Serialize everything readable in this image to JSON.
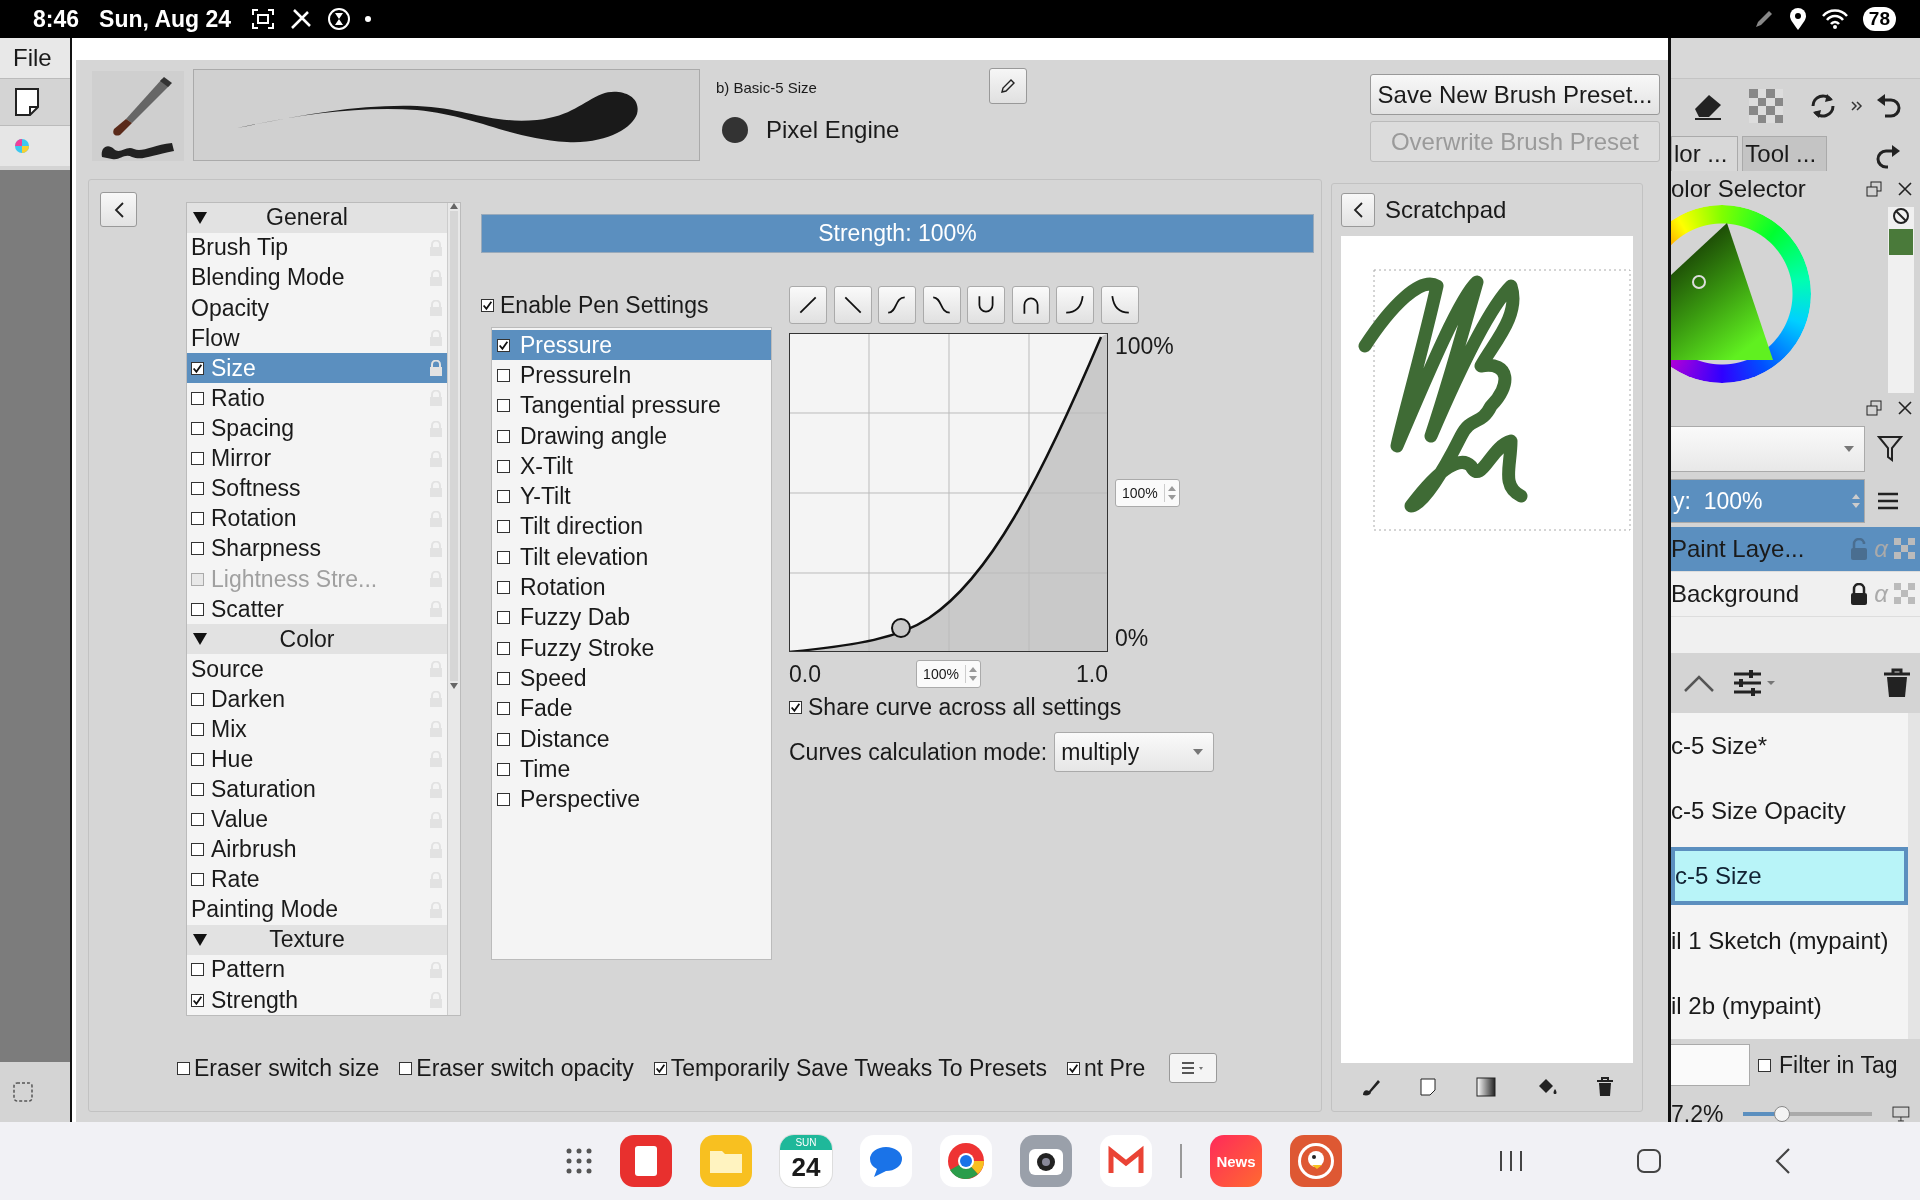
{
  "status_bar": {
    "time": "8:46",
    "date": "Sun, Aug 24",
    "battery": "78"
  },
  "menu": [
    "File"
  ],
  "preset": {
    "name": "b) Basic-5 Size",
    "engine": "Pixel Engine"
  },
  "preset_buttons": [
    {
      "label": "Save New Brush Preset...",
      "disabled": false
    },
    {
      "label": "Overwrite Brush Preset",
      "disabled": true
    }
  ],
  "options": [
    {
      "label": "General",
      "expanded": true,
      "children": [
        {
          "label": "Brush Tip",
          "kind": "plain",
          "selected": false
        },
        {
          "label": "Blending Mode",
          "kind": "plain",
          "selected": false
        },
        {
          "label": "Opacity",
          "kind": "plain",
          "selected": false
        },
        {
          "label": "Flow",
          "kind": "plain",
          "selected": false
        },
        {
          "label": "Size",
          "kind": "check",
          "checked": true,
          "selected": true,
          "disabled": false
        },
        {
          "label": "Ratio",
          "kind": "check",
          "checked": false,
          "selected": false,
          "disabled": false
        },
        {
          "label": "Spacing",
          "kind": "check",
          "checked": false,
          "selected": false,
          "disabled": false
        },
        {
          "label": "Mirror",
          "kind": "check",
          "checked": false,
          "selected": false,
          "disabled": false
        },
        {
          "label": "Softness",
          "kind": "check",
          "checked": false,
          "selected": false,
          "disabled": false
        },
        {
          "label": "Rotation",
          "kind": "check",
          "checked": false,
          "selected": false,
          "disabled": false
        },
        {
          "label": "Sharpness",
          "kind": "check",
          "checked": false,
          "selected": false,
          "disabled": false
        },
        {
          "label": "Lightness Stre...",
          "kind": "check",
          "checked": false,
          "selected": false,
          "disabled": true
        },
        {
          "label": "Scatter",
          "kind": "check",
          "checked": false,
          "selected": false,
          "disabled": false
        }
      ]
    },
    {
      "label": "Color",
      "expanded": true,
      "children": [
        {
          "label": "Source",
          "kind": "plain",
          "selected": false
        },
        {
          "label": "Darken",
          "kind": "check",
          "checked": false,
          "selected": false,
          "disabled": false
        },
        {
          "label": "Mix",
          "kind": "check",
          "checked": false,
          "selected": false,
          "disabled": false
        },
        {
          "label": "Hue",
          "kind": "check",
          "checked": false,
          "selected": false,
          "disabled": false
        },
        {
          "label": "Saturation",
          "kind": "check",
          "checked": false,
          "selected": false,
          "disabled": false
        },
        {
          "label": "Value",
          "kind": "check",
          "checked": false,
          "selected": false,
          "disabled": false
        },
        {
          "label": "Airbrush",
          "kind": "check",
          "checked": false,
          "selected": false,
          "disabled": false
        },
        {
          "label": "Rate",
          "kind": "check",
          "checked": false,
          "selected": false,
          "disabled": false
        },
        {
          "label": "Painting Mode",
          "kind": "plain",
          "selected": false
        }
      ]
    },
    {
      "label": "Texture",
      "expanded": true,
      "children": [
        {
          "label": "Pattern",
          "kind": "check",
          "checked": false,
          "selected": false,
          "disabled": false
        },
        {
          "label": "Strength",
          "kind": "check",
          "checked": true,
          "selected": false,
          "disabled": false
        }
      ]
    }
  ],
  "strength": {
    "label": "Strength: 100%",
    "level": 1
  },
  "pen_settings": {
    "label": "Enable Pen Settings",
    "checked": true
  },
  "sensors": [
    {
      "label": "Pressure",
      "checked": true,
      "selected": true
    },
    {
      "label": "PressureIn",
      "checked": false,
      "selected": false
    },
    {
      "label": "Tangential pressure",
      "checked": false,
      "selected": false
    },
    {
      "label": "Drawing angle",
      "checked": false,
      "selected": false
    },
    {
      "label": "X-Tilt",
      "checked": false,
      "selected": false
    },
    {
      "label": "Y-Tilt",
      "checked": false,
      "selected": false
    },
    {
      "label": "Tilt direction",
      "checked": false,
      "selected": false
    },
    {
      "label": "Tilt elevation",
      "checked": false,
      "selected": false
    },
    {
      "label": "Rotation",
      "checked": false,
      "selected": false
    },
    {
      "label": "Fuzzy Dab",
      "checked": false,
      "selected": false
    },
    {
      "label": "Fuzzy Stroke",
      "checked": false,
      "selected": false
    },
    {
      "label": "Speed",
      "checked": false,
      "selected": false
    },
    {
      "label": "Fade",
      "checked": false,
      "selected": false
    },
    {
      "label": "Distance",
      "checked": false,
      "selected": false
    },
    {
      "label": "Time",
      "checked": false,
      "selected": false
    },
    {
      "label": "Perspective",
      "checked": false,
      "selected": false
    }
  ],
  "curve": {
    "y_max": "100%",
    "y_min": "0%",
    "x_min": "0.0",
    "x_max": "1.0",
    "y_spin": "100%",
    "x_spin": "100%"
  },
  "share_curve": {
    "label": "Share curve across all settings",
    "checked": true
  },
  "calc_mode": {
    "label": "Curves calculation mode:",
    "value": "multiply"
  },
  "scratchpad": {
    "title": "Scratchpad"
  },
  "bottom_options": [
    {
      "label": "Eraser switch size",
      "checked": false
    },
    {
      "label": "Eraser switch opacity",
      "checked": false
    },
    {
      "label": "Temporarily Save Tweaks To Presets",
      "checked": true
    },
    {
      "label": "nt Pre",
      "checked": true
    }
  ],
  "docker": {
    "tabs": [
      {
        "label": "lor ...",
        "selected": true
      },
      {
        "label": "Tool ...",
        "selected": false
      }
    ],
    "color_selector_title": "olor Selector",
    "layer_opacity": {
      "label": "y:  100%",
      "level": 1
    },
    "layers": [
      {
        "name": "Paint Laye...",
        "selected": true,
        "locked": false,
        "alpha": "α"
      },
      {
        "name": "Background",
        "selected": false,
        "locked": true,
        "alpha": "α"
      }
    ],
    "presets": [
      {
        "name": "c-5 Size*",
        "selected": false
      },
      {
        "name": "c-5 Size Opacity",
        "selected": false
      },
      {
        "name": "c-5 Size",
        "selected": true
      },
      {
        "name": "il 1 Sketch (mypaint)",
        "selected": false
      },
      {
        "name": "il 2b (mypaint)",
        "selected": false
      }
    ],
    "filter": {
      "label": "Filter in Tag",
      "checked": false
    },
    "zoom": {
      "value": "7.2%",
      "level": 0.3
    }
  },
  "navbar": {
    "calendar_day": "SUN",
    "calendar_date": "24",
    "news": "News"
  }
}
